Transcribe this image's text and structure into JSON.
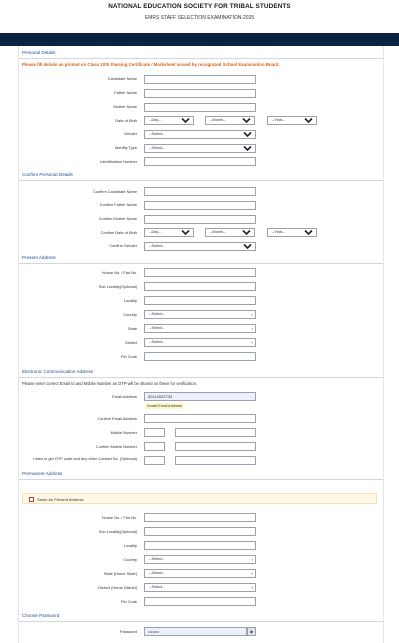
{
  "header": {
    "title": "NATIONAL EDUCATION SOCIETY FOR TRIBAL STUDENTS",
    "subtitle": "EMRS STAFF SELECTION EXAMINATION-2025"
  },
  "personal": {
    "heading": "Personal Details",
    "note": "Please fill details as printed on Class 10th Passing Certificate / Marksheet issued by recognized School Examination Board.",
    "candidate_name": "Candidate Name",
    "father_name": "Father Name",
    "mother_name": "Mother Name",
    "dob": "Date of Birth",
    "gender": "Gender",
    "identity_type": "Identity Type",
    "identification_number": "Identification Number",
    "day_placeholder": "--Day--",
    "month_placeholder": "--Month--",
    "year_placeholder": "--Year--",
    "select_placeholder": "--Select--"
  },
  "confirm": {
    "heading": "Confirm Personal Details",
    "candidate_name": "Confirm Candidate Name",
    "father_name": "Confirm Father Name",
    "mother_name": "Confirm Mother Name",
    "dob": "Confirm Date of Birth",
    "gender": "Confirm Gender",
    "day_placeholder": "--Day--",
    "month_placeholder": "--Month--",
    "year_placeholder": "--Year--",
    "select_placeholder": "--Select--"
  },
  "present": {
    "heading": "Present Address",
    "house": "House No. / Flat No.",
    "sublocality": "Sub Locality(Optional)",
    "locality": "Locality",
    "country": "Country",
    "state": "State",
    "district": "District",
    "pincode": "Pin Code",
    "select_placeholder": "--Select--"
  },
  "electronic": {
    "heading": "Electronic Communication Address",
    "note": "Please enter correct Email Id and Mobile Number as OTP will be shared on these for verification.",
    "email": "Email Address",
    "email_value": "00110022733",
    "email_error": "Invalid Email Address!",
    "confirm_email": "Confirm Email Address",
    "mobile": "Mobile Number",
    "confirm_mobile": "Confirm Mobile Number",
    "otp_question": "I wish to get OTP code and any other Contact No. (Optional)"
  },
  "permanent": {
    "heading": "Permanent Address",
    "same_as_present": "Same As Present Address",
    "house": "House No. / Flat No.",
    "sublocality": "Sub Locality(Optional)",
    "locality": "Locality",
    "country": "Country",
    "state": "State (Home State)",
    "district": "District (Home District)",
    "pincode": "Pin Code",
    "select_placeholder": "--Select--"
  },
  "password": {
    "heading": "Choose Password",
    "label": "Password",
    "masked_value": "••••••••",
    "eye_icon": "eye-icon"
  },
  "colors": {
    "navbar": "#0c2340",
    "section_heading": "#1f4f8f",
    "note": "#d0661a",
    "error_bg": "#fff8c8"
  }
}
